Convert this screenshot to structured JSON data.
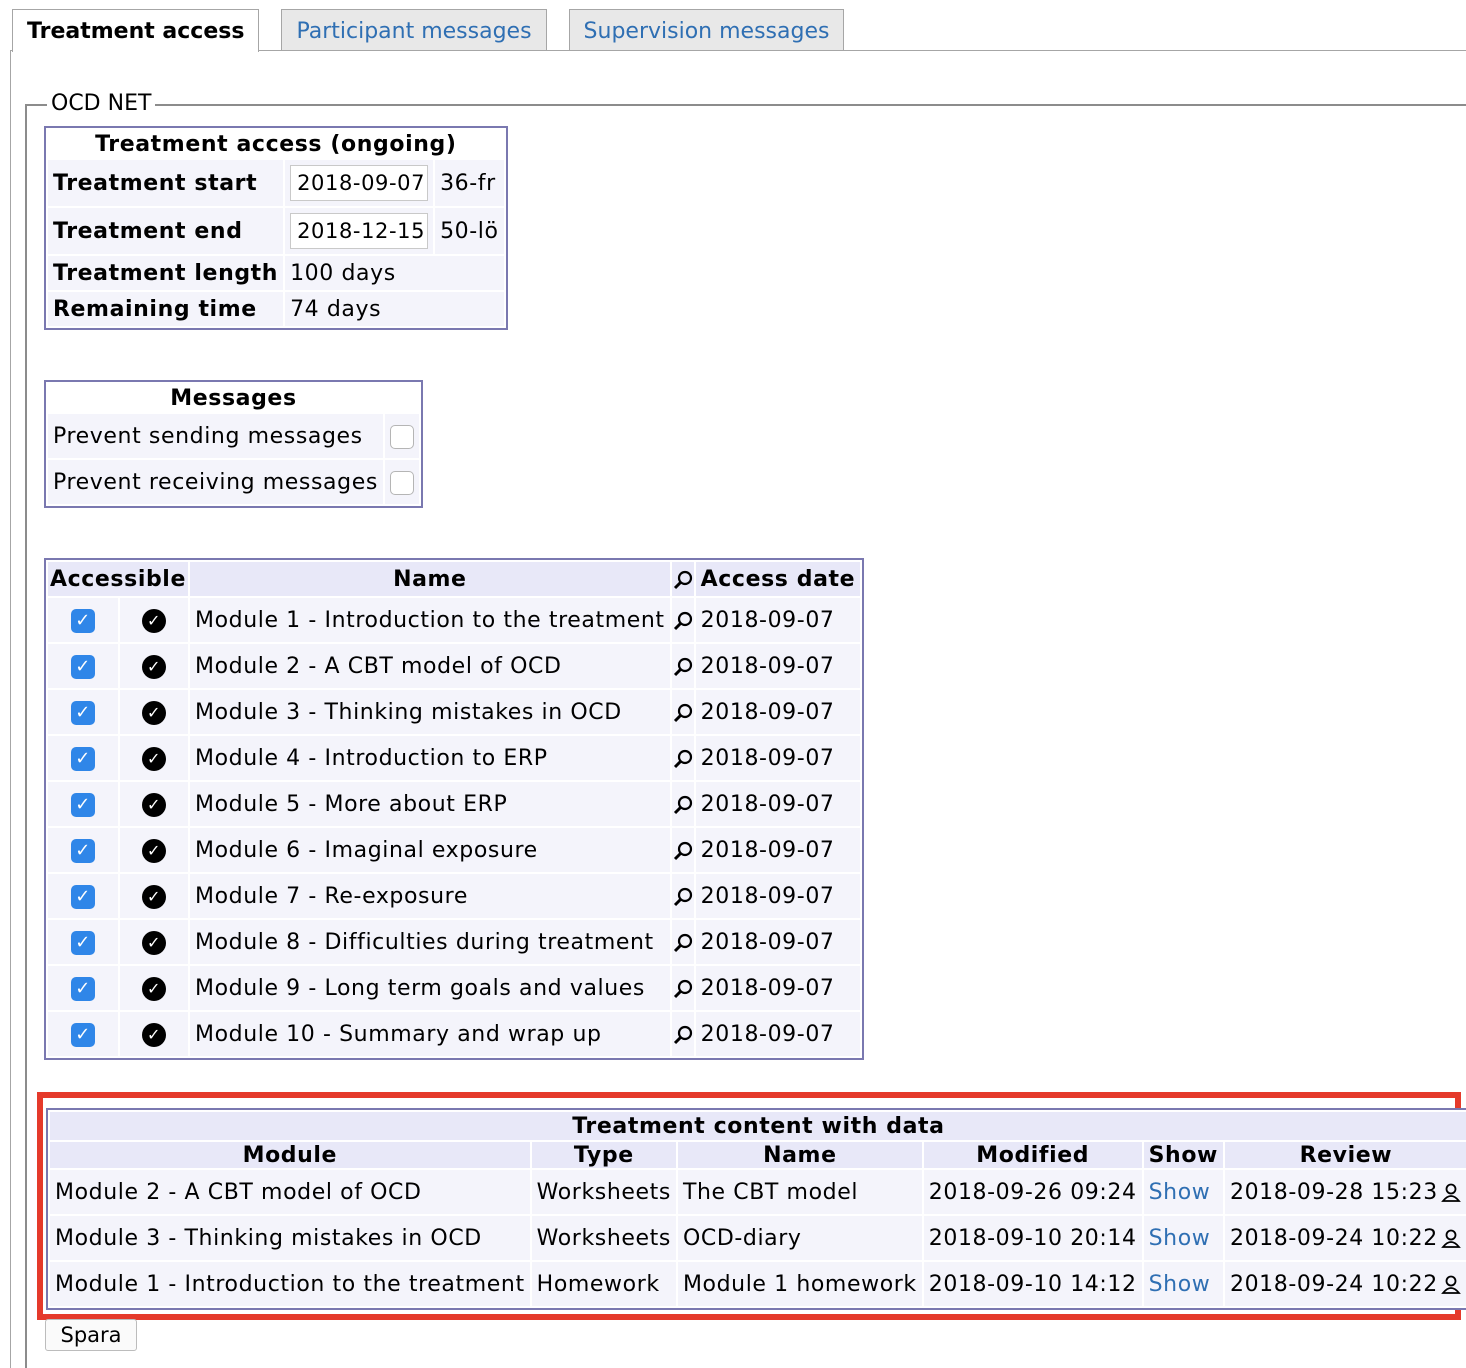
{
  "tabs": [
    "Treatment access",
    "Participant messages",
    "Supervision messages"
  ],
  "fieldset_legend": "OCD NET",
  "treatment_access": {
    "caption": "Treatment access (ongoing)",
    "start_label": "Treatment start",
    "start_value": "2018-09-07",
    "start_week": "36-fr",
    "end_label": "Treatment end",
    "end_value": "2018-12-15",
    "end_week": "50-lö",
    "length_label": "Treatment length",
    "length_value": "100 days",
    "remaining_label": "Remaining time",
    "remaining_value": "74 days"
  },
  "messages": {
    "caption": "Messages",
    "prevent_sending_label": "Prevent sending messages",
    "prevent_sending_checked": false,
    "prevent_receiving_label": "Prevent receiving messages",
    "prevent_receiving_checked": false
  },
  "modules_table": {
    "headers": [
      "Accessible",
      "Name",
      "Access date"
    ],
    "rows": [
      {
        "name": "Module 1 - Introduction to the treatment",
        "date": "2018-09-07",
        "accessible": true
      },
      {
        "name": "Module 2 - A CBT model of OCD",
        "date": "2018-09-07",
        "accessible": true
      },
      {
        "name": "Module 3 - Thinking mistakes in OCD",
        "date": "2018-09-07",
        "accessible": true
      },
      {
        "name": "Module 4 - Introduction to ERP",
        "date": "2018-09-07",
        "accessible": true
      },
      {
        "name": "Module 5 - More about ERP",
        "date": "2018-09-07",
        "accessible": true
      },
      {
        "name": "Module 6 - Imaginal exposure",
        "date": "2018-09-07",
        "accessible": true
      },
      {
        "name": "Module 7 - Re-exposure",
        "date": "2018-09-07",
        "accessible": true
      },
      {
        "name": "Module 8 - Difficulties during treatment",
        "date": "2018-09-07",
        "accessible": true
      },
      {
        "name": "Module 9 - Long term goals and values",
        "date": "2018-09-07",
        "accessible": true
      },
      {
        "name": "Module 10 - Summary and wrap up",
        "date": "2018-09-07",
        "accessible": true
      }
    ]
  },
  "content_table": {
    "caption": "Treatment content with data",
    "headers": [
      "Module",
      "Type",
      "Name",
      "Modified",
      "Show",
      "Review"
    ],
    "rows": [
      {
        "module": "Module 2 - A CBT model of OCD",
        "type": "Worksheets",
        "name": "The CBT model",
        "modified": "2018-09-26 09:24",
        "show": "Show",
        "review": "2018-09-28 15:23"
      },
      {
        "module": "Module 3 - Thinking mistakes in OCD",
        "type": "Worksheets",
        "name": "OCD-diary",
        "modified": "2018-09-10 20:14",
        "show": "Show",
        "review": "2018-09-24 10:22"
      },
      {
        "module": "Module 1 - Introduction to the treatment",
        "type": "Homework",
        "name": "Module 1 homework",
        "modified": "2018-09-10 14:12",
        "show": "Show",
        "review": "2018-09-24 10:22"
      }
    ]
  },
  "save_button": "Spara",
  "colors": {
    "accent_link": "#2f6fb3",
    "highlight_frame": "#e53a2b",
    "table_border": "#7a78b0",
    "checkbox": "#2f86e8"
  }
}
